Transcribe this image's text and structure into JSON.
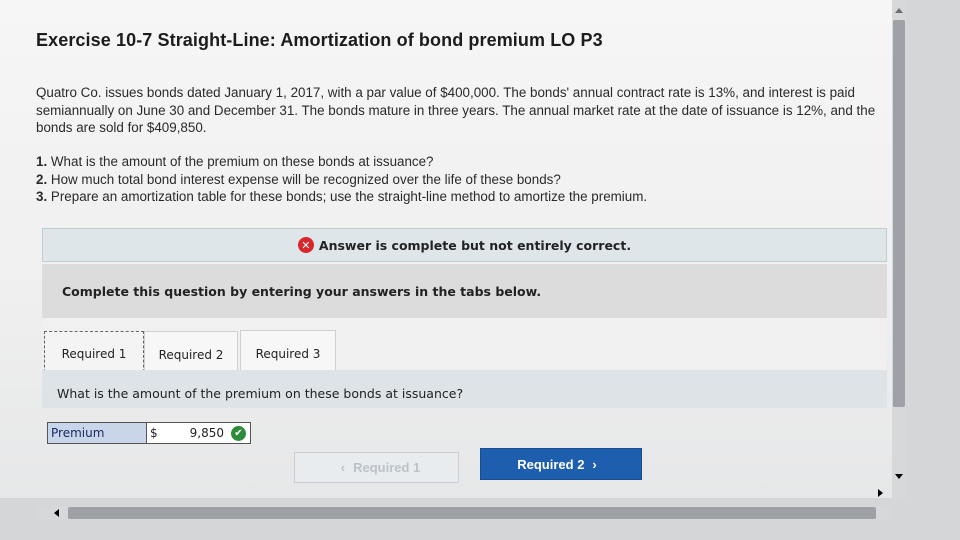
{
  "exercise": {
    "title": "Exercise 10-7 Straight-Line: Amortization of bond premium LO P3",
    "intro": "Quatro Co. issues bonds dated January 1, 2017, with a par value of $400,000. The bonds' annual contract rate is 13%, and interest is paid semiannually on June 30 and December 31. The bonds mature in three years. The annual market rate at the date of issuance is 12%, and the bonds are sold for $409,850.",
    "questions": [
      {
        "num": "1.",
        "text": "What is the amount of the premium on these bonds at issuance?"
      },
      {
        "num": "2.",
        "text": "How much total bond interest expense will be recognized over the life of these bonds?"
      },
      {
        "num": "3.",
        "text": "Prepare an amortization table for these bonds; use the straight-line method to amortize the premium."
      }
    ]
  },
  "status": {
    "text": "Answer is complete but not entirely correct.",
    "icon": "error-x-icon",
    "color": "#d9262c"
  },
  "instruction": "Complete this question by entering your answers in the tabs below.",
  "tabs": [
    {
      "label": "Required 1",
      "active": true
    },
    {
      "label": "Required 2",
      "active": false
    },
    {
      "label": "Required 3",
      "active": false
    }
  ],
  "question_prompt": "What is the amount of the premium on these bonds at issuance?",
  "answer": {
    "label": "Premium",
    "currency": "$",
    "value": "9,850",
    "correct": true
  },
  "navigation": {
    "prev_label": "Required 1",
    "next_label": "Required 2",
    "prev_icon": "chevron-left-icon",
    "next_icon": "chevron-right-icon",
    "accent": "#1d5fae"
  }
}
